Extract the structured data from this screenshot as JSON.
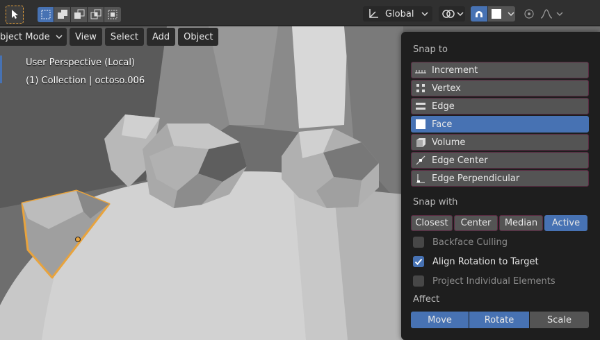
{
  "header": {
    "orientation": "Global",
    "colors": {
      "accent": "#4772b3",
      "select_outline": "#e8a33d",
      "header_bg": "#303030",
      "popover_bg": "#1e1e1e",
      "button_bg": "#545454"
    },
    "icons": [
      "select-box-icon",
      "mode-new-icon",
      "mode-extend-icon",
      "mode-subtract-icon",
      "mode-invert-icon",
      "mode-intersect-icon",
      "orientation-icon",
      "pivot-icon",
      "snap-magnet-icon",
      "snap-face-icon",
      "proportional-edit-icon",
      "falloff-icon"
    ]
  },
  "menubar": {
    "mode": "bject Mode",
    "view": "View",
    "select": "Select",
    "add": "Add",
    "object": "Object"
  },
  "viewport": {
    "perspective": "User Perspective (Local)",
    "collection": "(1) Collection | octoso.006"
  },
  "popover": {
    "snap_to_label": "Snap to",
    "snap_to": [
      {
        "label": "Increment",
        "icon": "increment-icon",
        "active": false
      },
      {
        "label": "Vertex",
        "icon": "vertex-icon",
        "active": false
      },
      {
        "label": "Edge",
        "icon": "edge-icon",
        "active": false
      },
      {
        "label": "Face",
        "icon": "face-icon",
        "active": true
      },
      {
        "label": "Volume",
        "icon": "volume-icon",
        "active": false
      },
      {
        "label": "Edge Center",
        "icon": "edge-center-icon",
        "active": false
      },
      {
        "label": "Edge Perpendicular",
        "icon": "edge-perpendicular-icon",
        "active": false
      }
    ],
    "snap_with_label": "Snap with",
    "snap_with": [
      {
        "label": "Closest",
        "active": false
      },
      {
        "label": "Center",
        "active": false
      },
      {
        "label": "Median",
        "active": false
      },
      {
        "label": "Active",
        "active": true
      }
    ],
    "options": [
      {
        "label": "Backface Culling",
        "checked": false,
        "enabled": false
      },
      {
        "label": "Align Rotation to Target",
        "checked": true,
        "enabled": true
      },
      {
        "label": "Project Individual Elements",
        "checked": false,
        "enabled": false
      }
    ],
    "affect_label": "Affect",
    "affect": [
      {
        "label": "Move",
        "active": true
      },
      {
        "label": "Rotate",
        "active": true
      },
      {
        "label": "Scale",
        "active": false
      }
    ]
  }
}
